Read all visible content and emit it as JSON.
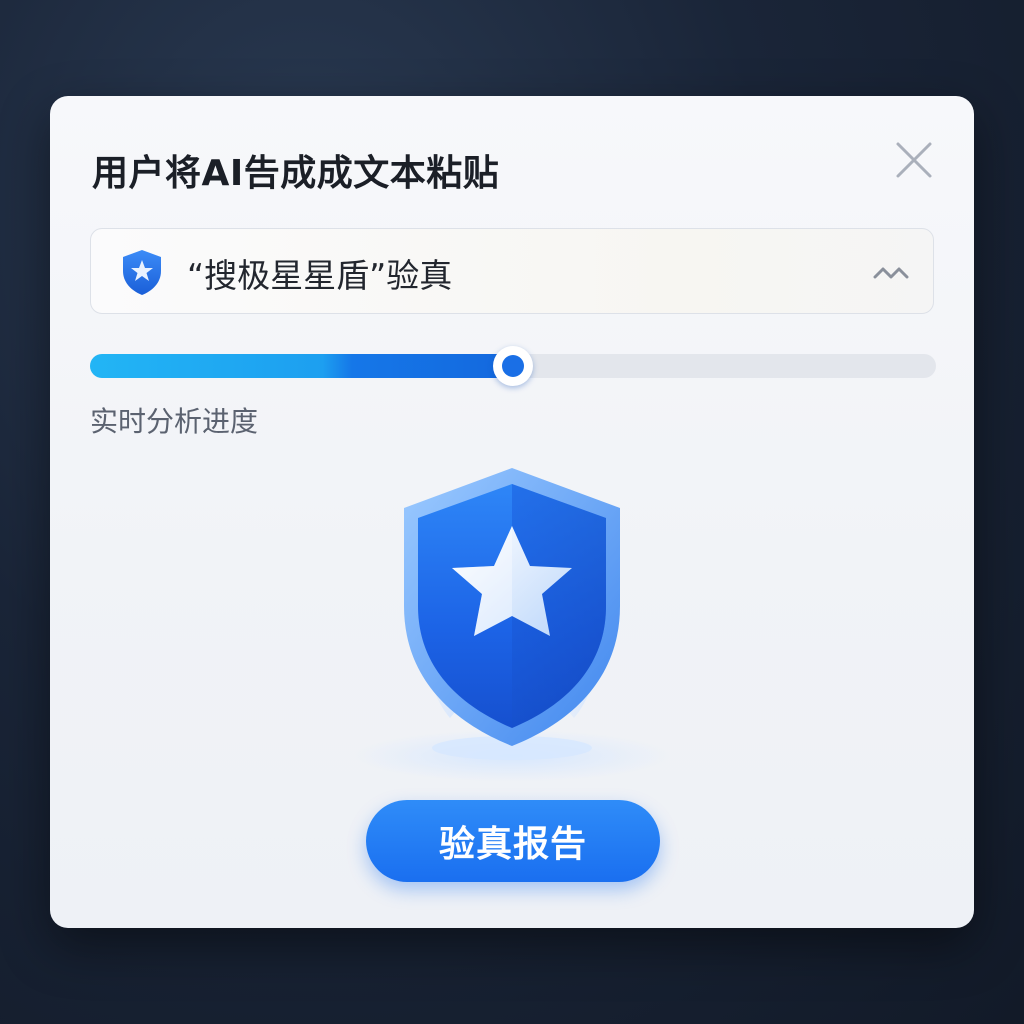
{
  "dialog": {
    "title": "用户将AI告成成文本粘贴",
    "close_icon": "close-icon"
  },
  "source_select": {
    "icon": "shield-star-icon",
    "value": "“搜极星星盾”验真",
    "caret_icon": "chevron-icon"
  },
  "progress": {
    "fraction": 0.5,
    "label": "实时分析进度"
  },
  "illustration": {
    "icon": "shield-star-icon"
  },
  "actions": {
    "report_label": "验真报告"
  },
  "colors": {
    "accent": "#1a6ff0",
    "progress_start": "#22b5f5",
    "progress_end": "#1468de",
    "track": "#e3e6ec"
  }
}
